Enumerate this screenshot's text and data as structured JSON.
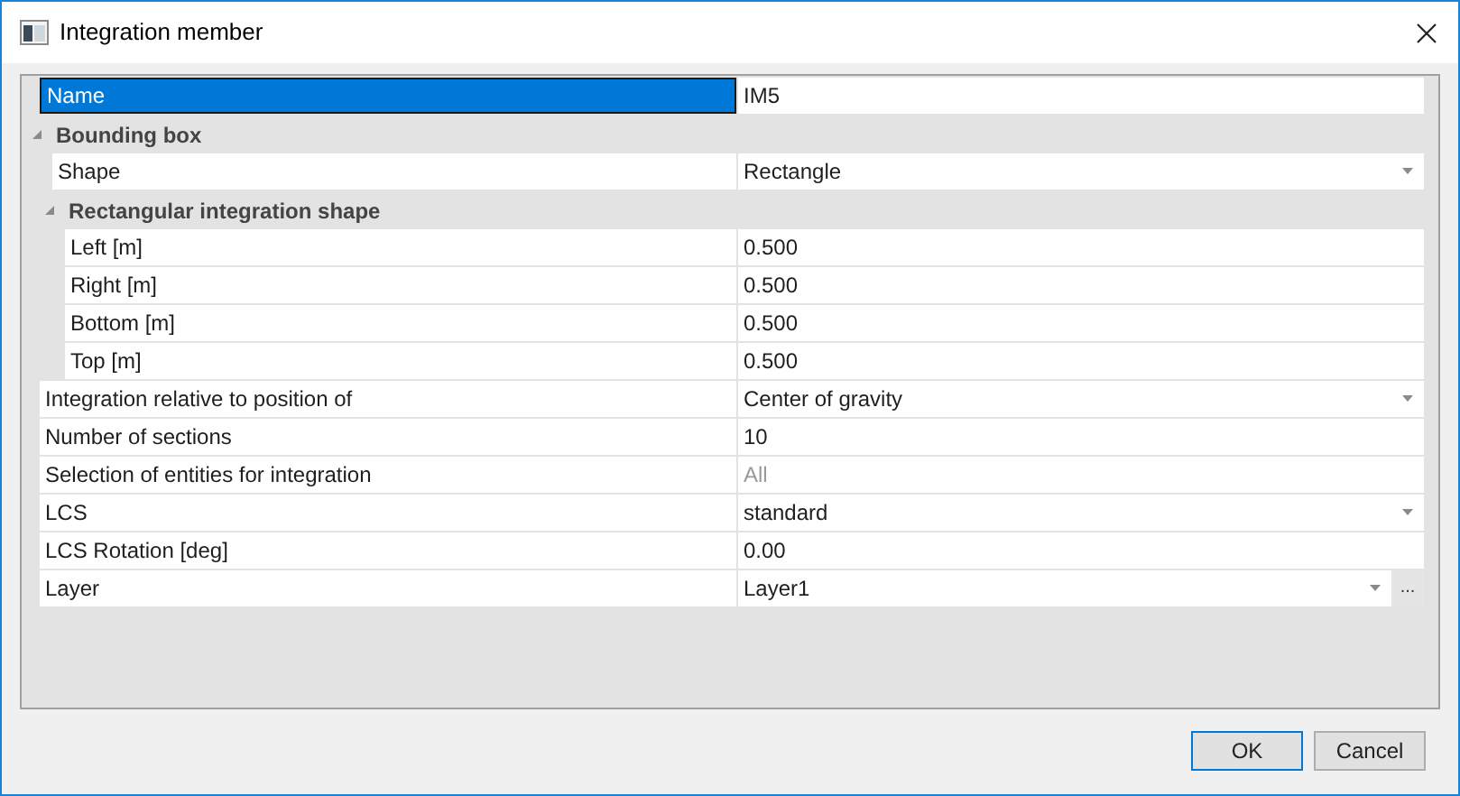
{
  "window": {
    "title": "Integration member"
  },
  "properties": [
    {
      "kind": "property",
      "label": "Name",
      "value": "IM5",
      "selected": true,
      "dropdown": false,
      "disabled": false
    },
    {
      "kind": "category",
      "label": "Bounding box",
      "expanded": true,
      "children": [
        {
          "kind": "property",
          "label": "Shape",
          "value": "Rectangle",
          "selected": false,
          "dropdown": true,
          "disabled": false
        },
        {
          "kind": "category",
          "label": "Rectangular integration shape",
          "expanded": true,
          "children": [
            {
              "kind": "property",
              "label": "Left [m]",
              "value": "0.500",
              "selected": false,
              "dropdown": false,
              "disabled": false
            },
            {
              "kind": "property",
              "label": "Right [m]",
              "value": "0.500",
              "selected": false,
              "dropdown": false,
              "disabled": false
            },
            {
              "kind": "property",
              "label": "Bottom [m]",
              "value": "0.500",
              "selected": false,
              "dropdown": false,
              "disabled": false
            },
            {
              "kind": "property",
              "label": "Top [m]",
              "value": "0.500",
              "selected": false,
              "dropdown": false,
              "disabled": false
            }
          ]
        }
      ]
    },
    {
      "kind": "property",
      "label": "Integration relative to position of",
      "value": "Center of gravity",
      "selected": false,
      "dropdown": true,
      "disabled": false
    },
    {
      "kind": "property",
      "label": "Number of sections",
      "value": "10",
      "selected": false,
      "dropdown": false,
      "disabled": false
    },
    {
      "kind": "property",
      "label": "Selection of entities for integration",
      "value": "All",
      "selected": false,
      "dropdown": false,
      "disabled": true
    },
    {
      "kind": "property",
      "label": "LCS",
      "value": "standard",
      "selected": false,
      "dropdown": true,
      "disabled": false
    },
    {
      "kind": "property",
      "label": "LCS Rotation [deg]",
      "value": "0.00",
      "selected": false,
      "dropdown": false,
      "disabled": false
    },
    {
      "kind": "property",
      "label": "Layer",
      "value": "Layer1",
      "selected": false,
      "dropdown": true,
      "disabled": false,
      "browse_button": "..."
    }
  ],
  "buttons": [
    {
      "label": "OK",
      "default": true
    },
    {
      "label": "Cancel",
      "default": false
    }
  ]
}
